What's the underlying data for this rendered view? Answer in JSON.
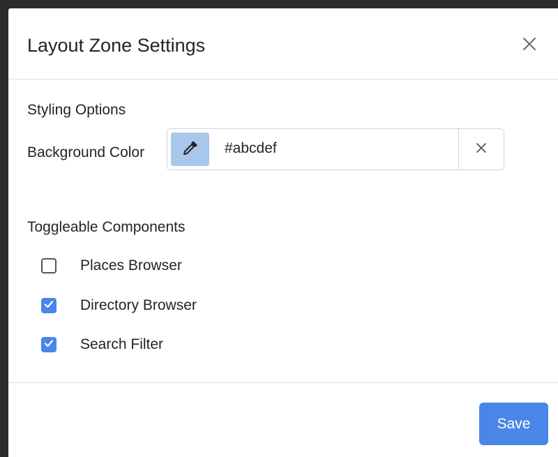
{
  "dialog": {
    "title": "Layout Zone Settings",
    "close_icon": "close-icon"
  },
  "styling": {
    "section_title": "Styling Options",
    "background_label": "Background Color",
    "background_value": "#abcdef",
    "picker_icon": "eyedropper-icon",
    "picker_color": "#a9c7ea",
    "clear_icon": "close-icon"
  },
  "components": {
    "section_title": "Toggleable Components",
    "items": [
      {
        "label": "Places Browser",
        "checked": false
      },
      {
        "label": "Directory Browser",
        "checked": true
      },
      {
        "label": "Search Filter",
        "checked": true
      }
    ]
  },
  "footer": {
    "save_label": "Save",
    "accent_color": "#4a86e8"
  }
}
